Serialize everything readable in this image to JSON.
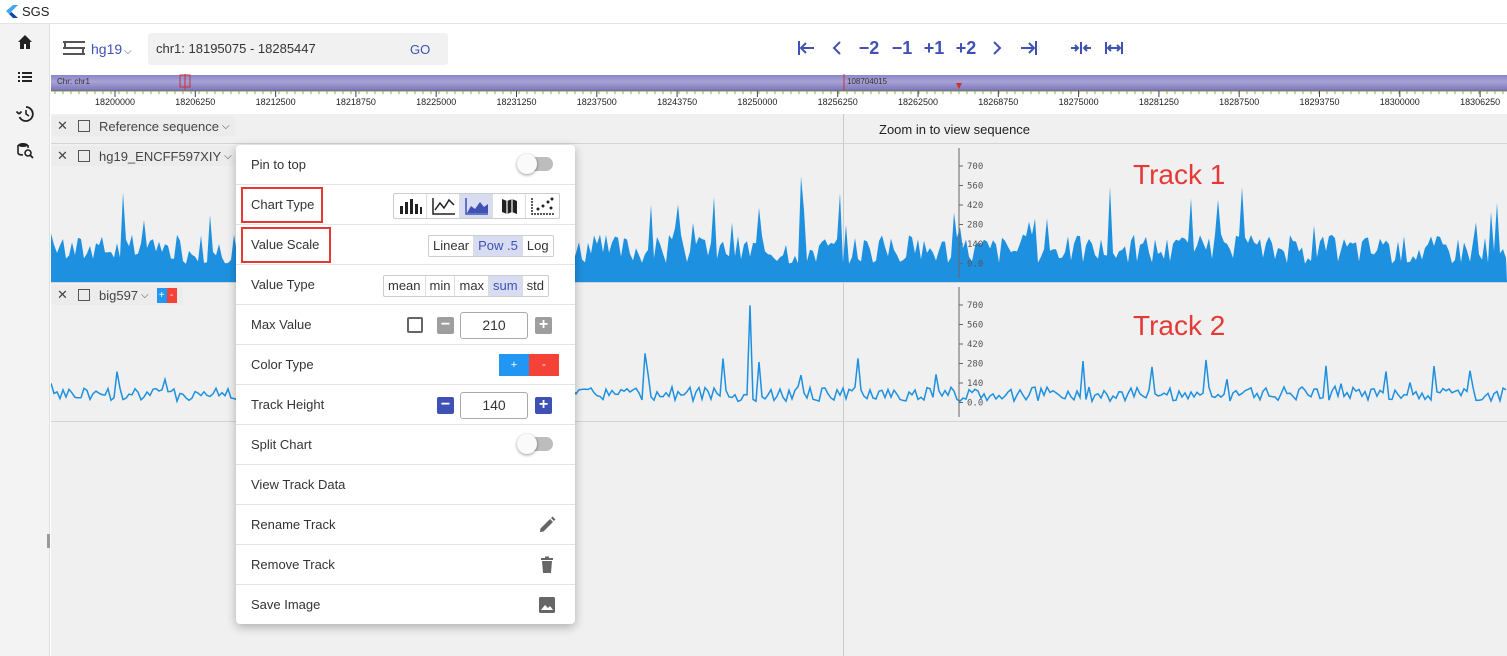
{
  "app": {
    "title": "SGS"
  },
  "sidebar": {
    "items": [
      {
        "icon": "home-icon"
      },
      {
        "icon": "list-icon"
      },
      {
        "icon": "history-icon"
      },
      {
        "icon": "search-data-icon"
      }
    ]
  },
  "toolbar": {
    "genome": "hg19",
    "locus": "chr1: 18195075 - 18285447",
    "go_label": "GO",
    "nav": [
      "|←",
      "<",
      "−2",
      "−1",
      "+1",
      "+2",
      ">",
      "→|",
      "→|←",
      "|↔|"
    ]
  },
  "ruler": {
    "chrom_label": "Chr: chr1",
    "position_label": "108704015",
    "ticks": [
      "18200000",
      "18206250",
      "18212500",
      "18218750",
      "18225000",
      "18231250",
      "18237500",
      "18243750",
      "18250000",
      "18256250",
      "18262500",
      "18268750",
      "18275000",
      "18281250",
      "18287500",
      "18293750",
      "18300000",
      "18306250"
    ]
  },
  "tracks": {
    "reference": {
      "name": "Reference sequence",
      "message": "Zoom in to view sequence"
    },
    "track1": {
      "name": "hg19_ENCFF597XIY",
      "big_label": "Track 1",
      "axis": [
        "700",
        "560",
        "420",
        "280",
        "140",
        "0.0"
      ]
    },
    "track2": {
      "name": "big597",
      "big_label": "Track 2",
      "axis": [
        "700",
        "560",
        "420",
        "280",
        "140",
        "0.0"
      ],
      "badge_plus": "+",
      "badge_minus": "-"
    }
  },
  "menu": {
    "pin_to_top": "Pin to top",
    "chart_type": "Chart Type",
    "value_scale": {
      "label": "Value Scale",
      "options": [
        "Linear",
        "Pow .5",
        "Log"
      ],
      "selected": "Pow .5"
    },
    "value_type": {
      "label": "Value Type",
      "options": [
        "mean",
        "min",
        "max",
        "sum",
        "std"
      ],
      "selected": "sum"
    },
    "max_value": {
      "label": "Max Value",
      "value": "210"
    },
    "color_type": {
      "label": "Color Type",
      "plus": "+",
      "minus": "-"
    },
    "track_height": {
      "label": "Track Height",
      "value": "140"
    },
    "split_chart": "Split Chart",
    "view_track_data": "View Track Data",
    "rename_track": "Rename Track",
    "remove_track": "Remove Track",
    "save_image": "Save Image"
  },
  "colors": {
    "accent": "#3f51b5",
    "track_fill": "#1e90e0",
    "highlight": "#e53935",
    "negative": "#f44336",
    "positive": "#2196f3"
  }
}
